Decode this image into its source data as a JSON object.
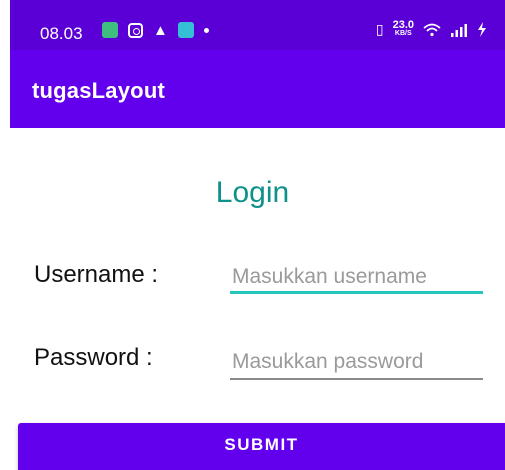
{
  "status_bar": {
    "time": "08.03",
    "notification_icons": [
      "app-notification-icon",
      "instagram-icon",
      "warning-icon",
      "chat-icon",
      "dot-icon"
    ],
    "net_speed_value": "23.0",
    "net_speed_unit": "KB/S",
    "right_icons": [
      "vibrate-icon",
      "wifi-icon",
      "signal-icon",
      "charging-icon"
    ]
  },
  "app_bar": {
    "title": "tugasLayout"
  },
  "login": {
    "title": "Login",
    "username_label": "Username :",
    "username_placeholder": "Masukkan username",
    "username_value": "",
    "password_label": "Password :",
    "password_placeholder": "Masukkan password",
    "password_value": "",
    "submit_label": "SUBMIT"
  },
  "colors": {
    "primary": "#6200ee",
    "status_bar": "#5a00d6",
    "title_teal": "#0e9189",
    "focused_underline": "#26c6bd"
  }
}
